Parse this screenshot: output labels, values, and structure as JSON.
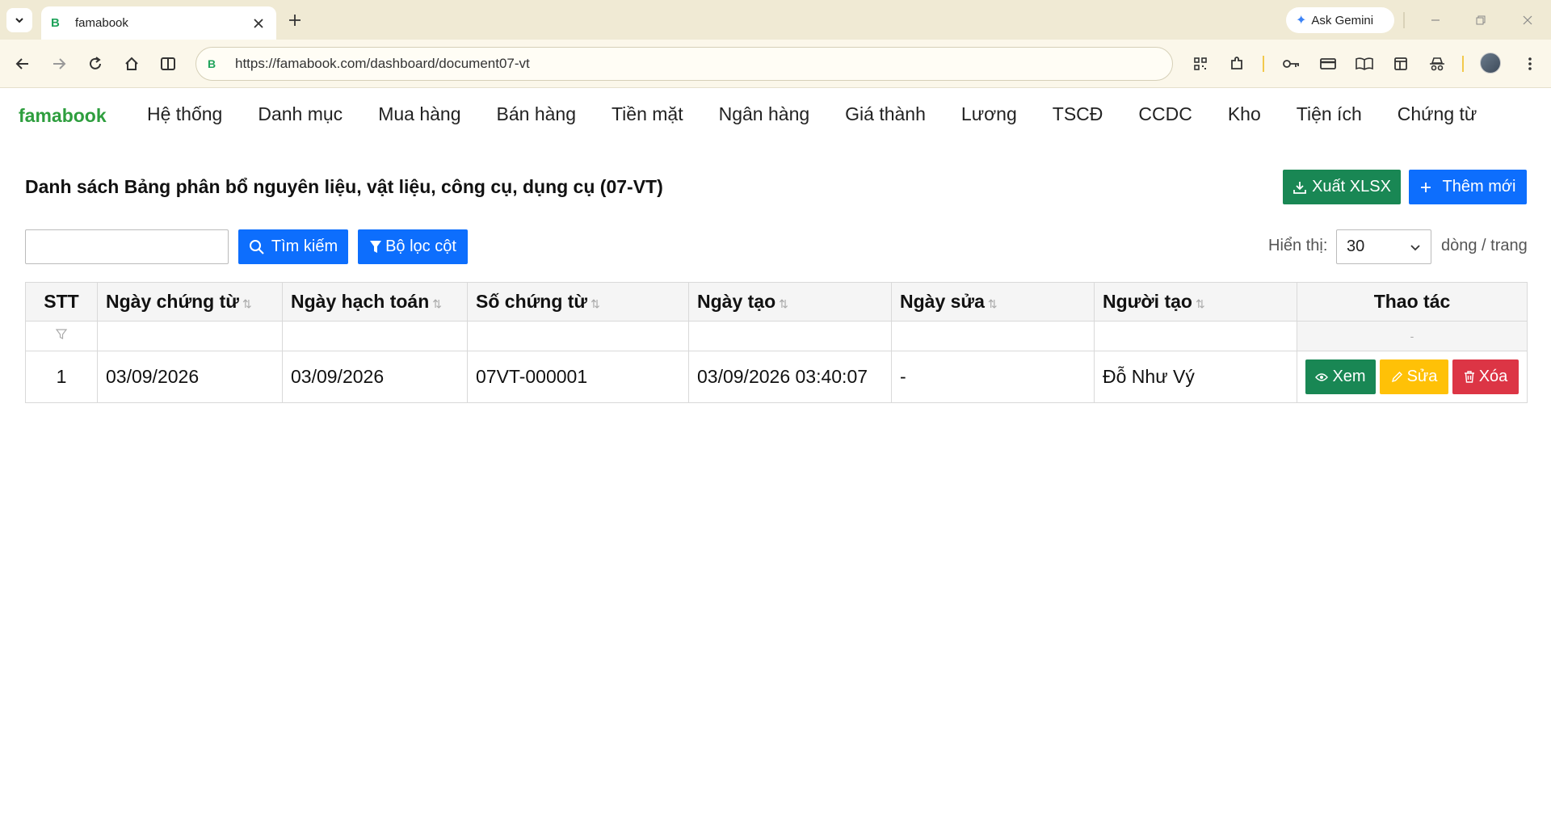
{
  "browser": {
    "tab_title": "famabook",
    "tab_favicon": "B",
    "url": "https://famabook.com/dashboard/document07-vt",
    "gemini_label": "Ask Gemini"
  },
  "app": {
    "brand": "famabook",
    "menu": [
      "Hệ thống",
      "Danh mục",
      "Mua hàng",
      "Bán hàng",
      "Tiền mặt",
      "Ngân hàng",
      "Giá thành",
      "Lương",
      "TSCĐ",
      "CCDC",
      "Kho",
      "Tiện ích",
      "Chứng từ"
    ]
  },
  "page": {
    "title": "Danh sách Bảng phân bổ nguyên liệu, vật liệu, công cụ, dụng cụ (07-VT)",
    "export_label": "Xuất XLSX",
    "add_label": "Thêm mới",
    "search_value": "",
    "search_label": "Tìm kiếm",
    "filter_label": "Bộ lọc cột",
    "show_label": "Hiển thị:",
    "page_size": "30",
    "per_page_label": "dòng / trang"
  },
  "table": {
    "columns": [
      "STT",
      "Ngày chứng từ",
      "Ngày hạch toán",
      "Số chứng từ",
      "Ngày tạo",
      "Ngày sửa",
      "Người tạo",
      "Thao tác"
    ],
    "action_filter_placeholder": "-",
    "rows": [
      {
        "stt": "1",
        "ngay_chung_tu": "03/09/2026",
        "ngay_hach_toan": "03/09/2026",
        "so_chung_tu": "07VT-000001",
        "ngay_tao": "03/09/2026 03:40:07",
        "ngay_sua": "-",
        "nguoi_tao": "Đỗ Như Vý"
      }
    ],
    "actions": {
      "view": "Xem",
      "edit": "Sửa",
      "delete": "Xóa"
    }
  },
  "colors": {
    "brand_green": "#2e9e3e",
    "success": "#198754",
    "primary": "#0d6efd",
    "warning": "#ffc107",
    "danger": "#dc3545",
    "chrome_tabbar": "#f0ead4"
  }
}
